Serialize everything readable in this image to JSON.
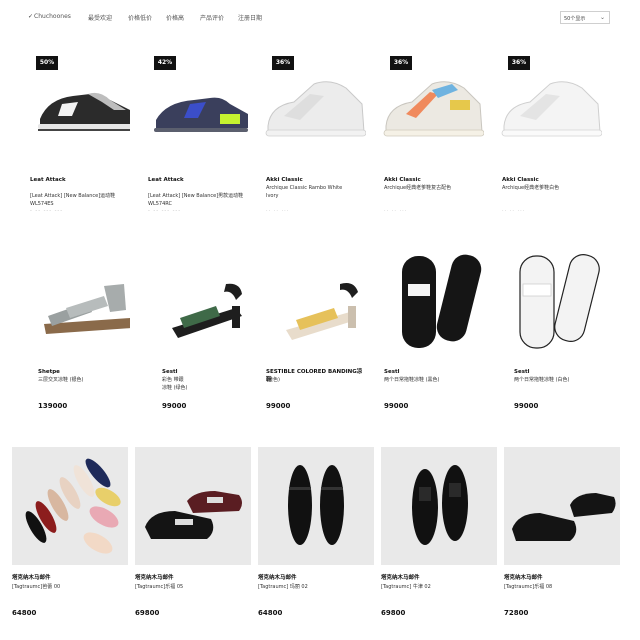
{
  "sort_bar": {
    "items": [
      {
        "label": "Chuchoones",
        "checked": true
      },
      {
        "label": "最受欢迎"
      },
      {
        "label": "价格低价"
      },
      {
        "label": "价格高"
      },
      {
        "label": "产品评价"
      },
      {
        "label": "注册日期"
      }
    ],
    "select_value": "50个显示",
    "select_caret": "⌄"
  },
  "rows": [
    [
      {
        "discount": "50%",
        "brand": "Leat Attack",
        "desc": "[Leat Attack] [New Balance]运动鞋 WL574ES",
        "price": "- -- --- ---"
      },
      {
        "discount": "42%",
        "brand": "Leat Attack",
        "desc": "[Leat Attack] [New Balance]男款运动鞋 WL574RC",
        "price": "- -- --- ---"
      },
      {
        "discount": "36%",
        "brand": "Akki Classic",
        "desc": "Archique Classic Rambo White Ivory",
        "price": "·· ·· ···"
      },
      {
        "discount": "36%",
        "brand": "Akki Classic",
        "desc": "Archique经典老爹鞋复古配色",
        "price": "·· ·· ···"
      },
      {
        "discount": "36%",
        "brand": "Akki Classic",
        "desc": "Archique经典老爹鞋白色",
        "price": "·· ·· ···"
      }
    ],
    [
      {
        "brand": "Shetpe",
        "desc": "三层交叉凉鞋 (银色)",
        "price": "139000"
      },
      {
        "brand": "Sestl",
        "desc": "彩色 带跟 凉鞋 (绿色)",
        "price": "99000"
      },
      {
        "brand": "SESTIBLE COLORED BANDING凉鞋",
        "desc": "(黄色)",
        "price": "99000"
      },
      {
        "brand": "Sestl",
        "desc": "两个日常拖鞋凉鞋 (黑色)",
        "price": "99000"
      },
      {
        "brand": "Sestl",
        "desc": "两个日常拖鞋凉鞋 (白色)",
        "price": "99000"
      }
    ],
    [
      {
        "brand": "塔克纳木马邮件",
        "desc": "[Tagtraumc]芭蕾 00",
        "price": "64800"
      },
      {
        "brand": "塔克纳木马邮件",
        "desc": "[Tagtraumc]乐福 05",
        "price": "69800"
      },
      {
        "brand": "塔克纳木马邮件",
        "desc": "[Tagtraumc] 玛丽 02",
        "price": "64800"
      },
      {
        "brand": "塔克纳木马邮件",
        "desc": "[Tagtraumc] 牛津 02",
        "price": "69800"
      },
      {
        "brand": "塔克纳木马邮件",
        "desc": "[Tagtraumc]乐福 08",
        "price": "72800"
      }
    ]
  ],
  "colors": {
    "sneaker_black": "#2b2b2b",
    "sneaker_navy": "#3a3f5c",
    "sneaker_cream": "#ece9e2",
    "sandal_silver": "#9aa0a0",
    "sandal_green": "#3f6a48",
    "sandal_yellow": "#e6c15a",
    "flat_bg": "#e9e9e9",
    "leather_black": "#141414",
    "burgundy": "#5a1d22"
  },
  "icons": [
    "checkmark-icon",
    "chevron-down-icon"
  ]
}
